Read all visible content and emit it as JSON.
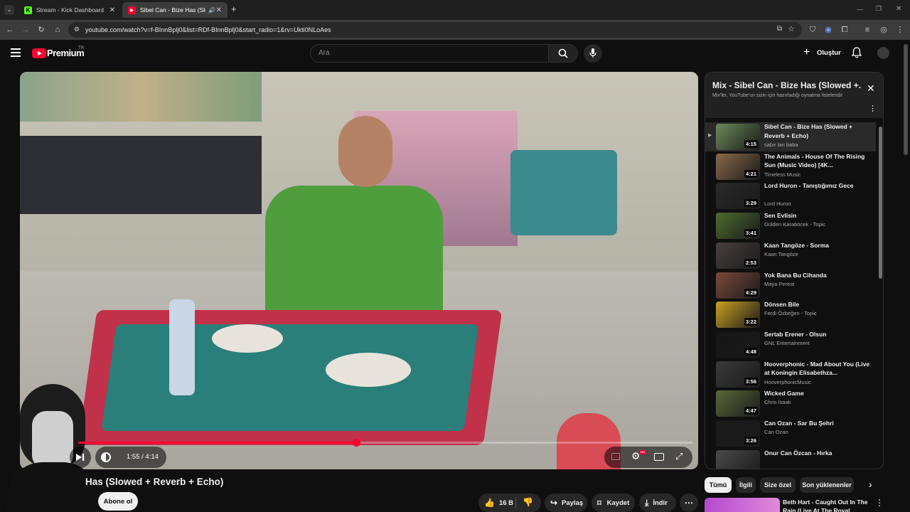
{
  "browser": {
    "tabs": [
      {
        "title": "Stream - Kick Dashboard",
        "active": false,
        "favicon": "kick-icon"
      },
      {
        "title": "Sibel Can - Bize Has (Slowe",
        "active": true,
        "favicon": "youtube-icon"
      }
    ],
    "new_tab": "+",
    "url": "youtube.com/watch?v=f-BInnBplj0&list=RDf-BInnBplj0&start_radio=1&rv=Ukti0NLoAes"
  },
  "header": {
    "logo": "Premium",
    "logo_region": "TR",
    "search_placeholder": "Ara",
    "create_label": "Oluştur"
  },
  "player": {
    "time": "1:55 / 4:14",
    "progress": 0.4528,
    "settings_badge": "HD"
  },
  "video": {
    "title_visible": "Has (Slowed + Reverb + Echo)",
    "subscribe_label": "Abone ol",
    "like_count": "16 B",
    "share_label": "Paylaş",
    "save_label": "Kaydet",
    "download_label": "İndir"
  },
  "playlist": {
    "title": "Mix - Sibel Can - Bize Has (Slowed +...",
    "subtitle": "Mix'ler, YouTube'un sizin için hazırladığı oynatma listeleridir",
    "items": [
      {
        "title": "Sibel Can - Bize Has (Slowed + Reverb + Echo)",
        "channel": "sabır lan baba",
        "duration": "4:15",
        "current": true,
        "thumb": "#6b8a5a"
      },
      {
        "title": "The Animals - House Of The Rising Sun (Music Video) [4K...",
        "channel": "Timeless Music",
        "duration": "4:21",
        "current": false,
        "thumb": "#8a6a4a"
      },
      {
        "title": "Lord Huron - Tanıştığımız Gece",
        "channel": "Lord Huron",
        "duration": "3:29",
        "current": false,
        "thumb": "#2a2a2a"
      },
      {
        "title": "Sen Evlisin",
        "channel": "Gülden Karaböcek - Topic",
        "duration": "3:41",
        "current": false,
        "thumb": "#4d6b2e"
      },
      {
        "title": "Kaan Tangöze - Sorma",
        "channel": "Kaan Tangöze",
        "duration": "2:53",
        "current": false,
        "thumb": "#4a4040"
      },
      {
        "title": "Yok Bana Bu Cihanda",
        "channel": "Maya Perest",
        "duration": "4:29",
        "current": false,
        "thumb": "#7a4a3a"
      },
      {
        "title": "Dönsen Bile",
        "channel": "Ferdi Özbeğen - Topic",
        "duration": "3:22",
        "current": false,
        "thumb": "#c9a020"
      },
      {
        "title": "Sertab Erener - Olsun",
        "channel": "GNL Entertainment",
        "duration": "4:48",
        "current": false,
        "thumb": "#151515"
      },
      {
        "title": "Hooverphonic - Mad About You (Live at Koningin Elisabethza...",
        "channel": "HooverphonicMusic",
        "duration": "3:56",
        "current": false,
        "thumb": "#3a3a3a"
      },
      {
        "title": "Wicked Game",
        "channel": "Chris Isaak",
        "duration": "4:47",
        "current": false,
        "thumb": "#5a6a3a"
      },
      {
        "title": "Can Ozan - Sar Bu Şehri",
        "channel": "Can Ozan",
        "duration": "3:26",
        "current": false,
        "thumb": "#1a1a1a"
      },
      {
        "title": "Onur Can Özcan - Hırka",
        "channel": "",
        "duration": "",
        "current": false,
        "thumb": "#4a4a4a"
      }
    ]
  },
  "chips": [
    "Tümü",
    "İlgili",
    "Size özel",
    "Son yüklenenler"
  ],
  "related": {
    "title": "Beth Hart - Caught Out In The Rain (Live At The Royal Albert..."
  },
  "colors": {
    "accent": "#ff0033",
    "background": "#0f0f0f"
  }
}
